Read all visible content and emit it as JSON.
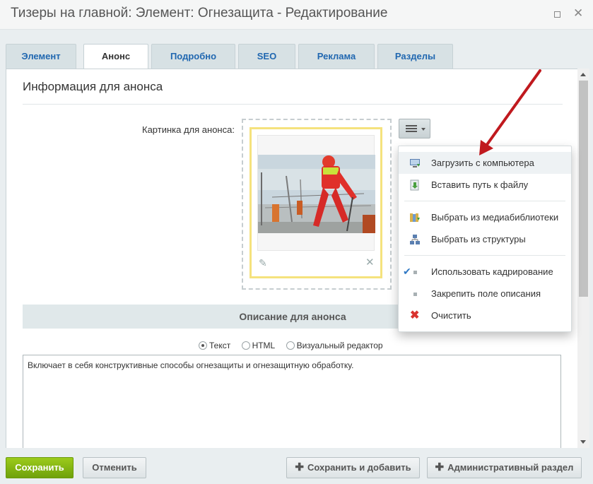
{
  "window": {
    "title": "Тизеры на главной: Элемент: Огнезащита - Редактирование",
    "maximize_icon": "maximize-icon",
    "close_icon": "close-icon"
  },
  "tabs": [
    {
      "label": "Элемент",
      "active": false
    },
    {
      "label": "Анонс",
      "active": true
    },
    {
      "label": "Подробно",
      "active": false
    },
    {
      "label": "SEO",
      "active": false
    },
    {
      "label": "Реклама",
      "active": false
    },
    {
      "label": "Разделы",
      "active": false
    }
  ],
  "section": {
    "title": "Информация для анонса",
    "picture_label": "Картинка для анонса:"
  },
  "menu": {
    "items": [
      {
        "label": "Загрузить с компьютера",
        "icon": "computer-upload-icon"
      },
      {
        "label": "Вставить путь к файлу",
        "icon": "file-path-icon"
      },
      {
        "label": "Выбрать из медиабиблиотеки",
        "icon": "medialibrary-icon"
      },
      {
        "label": "Выбрать из структуры",
        "icon": "structure-icon"
      },
      {
        "label": "Использовать кадрирование",
        "checked": true
      },
      {
        "label": "Закрепить поле описания",
        "checked": false
      },
      {
        "label": "Очистить",
        "icon": "clear-icon"
      }
    ]
  },
  "description": {
    "header": "Описание для анонса",
    "modes": [
      {
        "label": "Текст",
        "checked": true
      },
      {
        "label": "HTML",
        "checked": false
      },
      {
        "label": "Визуальный редактор",
        "checked": false
      }
    ],
    "text": "Включает в себя конструктивные способы огнезащиты и огнезащитную обработку."
  },
  "footer": {
    "save": "Сохранить",
    "cancel": "Отменить",
    "save_add": "Сохранить и добавить",
    "admin_section": "Административный раздел"
  },
  "colors": {
    "save_button": "#7fb212",
    "link": "#2067b0",
    "annotation_arrow": "#c0191e",
    "image_frame": "#f5e27d"
  }
}
